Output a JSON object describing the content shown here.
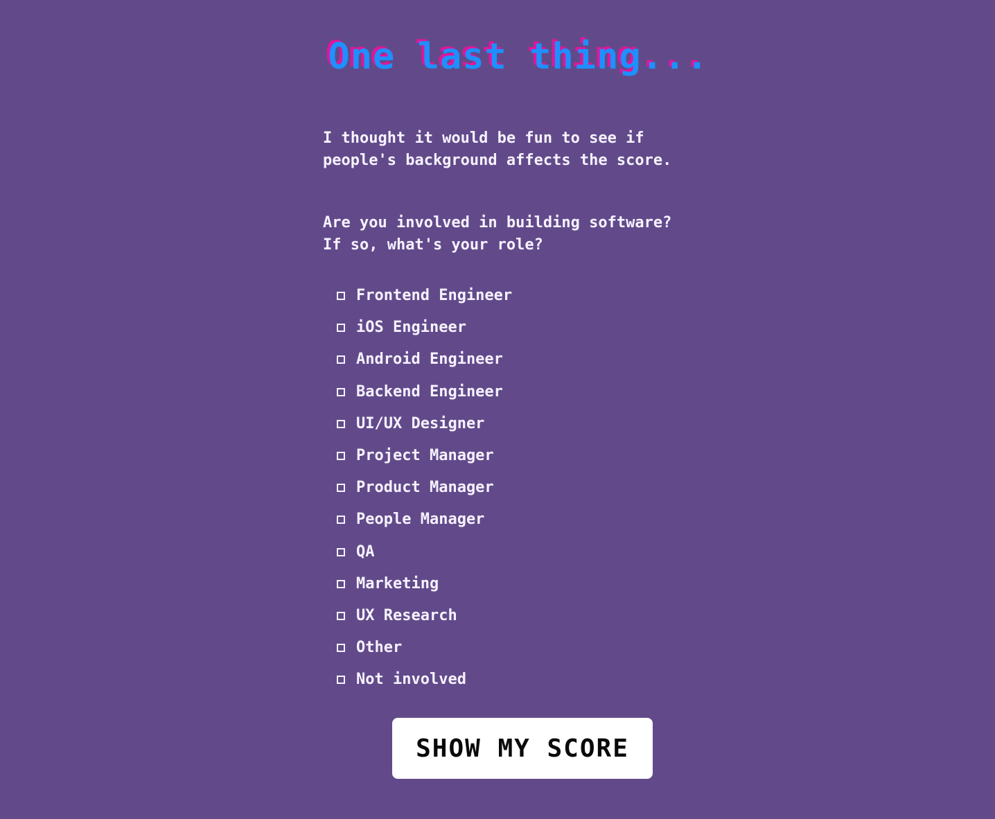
{
  "header": {
    "title": "One last thing..."
  },
  "intro": {
    "line1": "I thought it would be fun to see if",
    "line2": "people's background affects the score."
  },
  "question": {
    "line1": "Are you involved in building software?",
    "line2": "If so, what's your role?"
  },
  "roles": {
    "items": [
      {
        "label": "Frontend Engineer",
        "checked": false
      },
      {
        "label": "iOS Engineer",
        "checked": false
      },
      {
        "label": "Android Engineer",
        "checked": false
      },
      {
        "label": "Backend Engineer",
        "checked": false
      },
      {
        "label": "UI/UX Designer",
        "checked": false
      },
      {
        "label": "Project Manager",
        "checked": false
      },
      {
        "label": "Product Manager",
        "checked": false
      },
      {
        "label": "People Manager",
        "checked": false
      },
      {
        "label": "QA",
        "checked": false
      },
      {
        "label": "Marketing",
        "checked": false
      },
      {
        "label": "UX Research",
        "checked": false
      },
      {
        "label": "Other",
        "checked": false
      },
      {
        "label": "Not involved",
        "checked": false
      }
    ]
  },
  "actions": {
    "show_score_label": "SHOW MY SCORE"
  },
  "colors": {
    "background": "#624a8a",
    "title": "#1e90ff",
    "title_shadow": "#e0169a",
    "text": "#f6f2ff",
    "button_bg": "#ffffff",
    "button_text": "#0a0a0a"
  }
}
